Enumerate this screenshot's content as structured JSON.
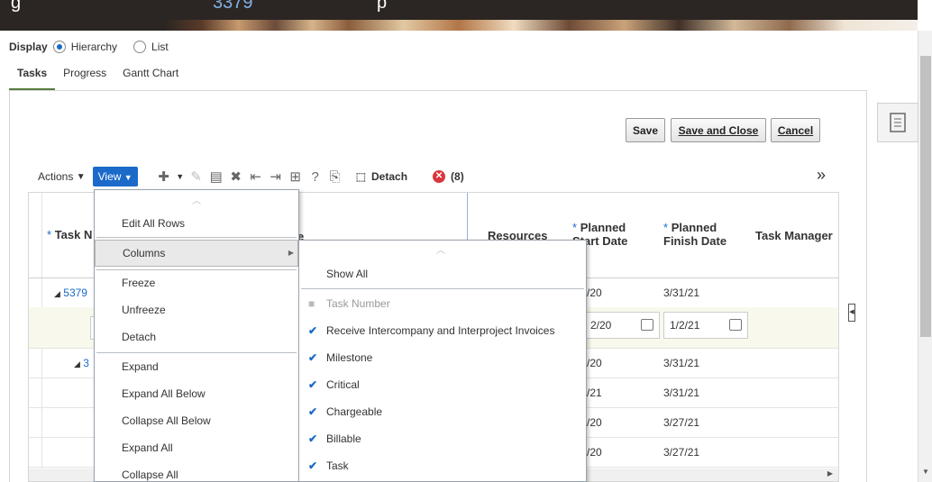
{
  "header": {
    "title_fragment_1": "g",
    "title_fragment_2": "3379",
    "title_fragment_3": "p"
  },
  "display": {
    "label": "Display",
    "option_hierarchy": "Hierarchy",
    "option_list": "List",
    "selected": "Hierarchy"
  },
  "tabs": [
    {
      "label": "Tasks",
      "active": true
    },
    {
      "label": "Progress"
    },
    {
      "label": "Gantt Chart"
    }
  ],
  "buttons": {
    "save": "Save",
    "save_and_close": "Save and Close",
    "cancel": "Cancel"
  },
  "toolbar": {
    "actions": "Actions",
    "view": "View",
    "detach": "Detach",
    "error_count": "(8)",
    "overflow": "»"
  },
  "grid": {
    "columns": {
      "task_name": "Task N",
      "task_name_suffix": "e",
      "resources": "Resources",
      "planned_start": [
        "Planned",
        "Start Date"
      ],
      "planned_finish": [
        "Planned",
        "Finish Date"
      ],
      "task_manager": "Task Manager"
    },
    "rows": [
      {
        "task": "5379",
        "start": "/20",
        "finish": "3/31/21"
      },
      {
        "start_input": "2/20",
        "finish_input": "1/2/21"
      },
      {
        "task": "3",
        "start": "/20",
        "finish": "3/31/21"
      },
      {
        "start": "/21",
        "finish": "3/31/21"
      },
      {
        "start": "/20",
        "finish": "3/27/21"
      },
      {
        "start": "/20",
        "finish": "3/27/21"
      }
    ]
  },
  "view_menu": {
    "items": [
      "Edit All Rows",
      "Columns",
      "Freeze",
      "Unfreeze",
      "Detach",
      "Expand",
      "Expand All Below",
      "Collapse All Below",
      "Expand All",
      "Collapse All"
    ]
  },
  "columns_menu": {
    "show_all": "Show All",
    "items": [
      {
        "label": "Task Number",
        "state": "disabled"
      },
      {
        "label": "Receive Intercompany and Interproject Invoices",
        "state": "checked"
      },
      {
        "label": "Milestone",
        "state": "checked"
      },
      {
        "label": "Critical",
        "state": "checked"
      },
      {
        "label": "Chargeable",
        "state": "checked"
      },
      {
        "label": "Billable",
        "state": "checked"
      },
      {
        "label": "Task",
        "state": "checked"
      }
    ]
  },
  "colors": {
    "accent": "#1b6ac9",
    "tab_underline": "#567c3c",
    "error": "#d9363e"
  }
}
